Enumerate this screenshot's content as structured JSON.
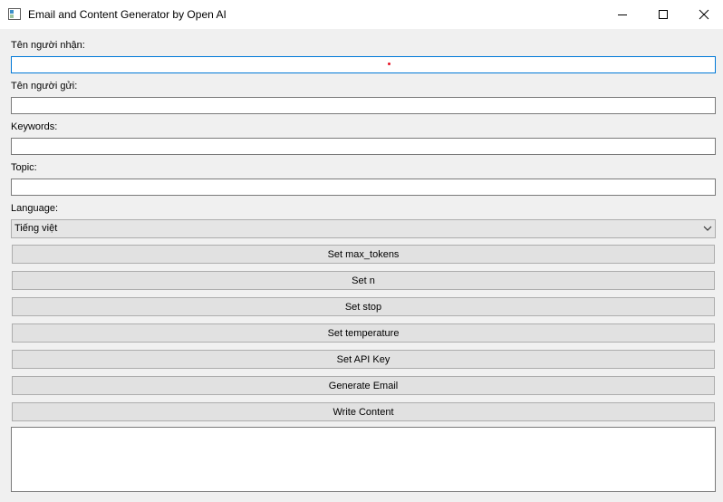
{
  "window": {
    "title": "Email and Content Generator by Open AI",
    "app_icon": "window-icon",
    "controls": [
      "minimize-icon",
      "maximize-icon",
      "close-icon"
    ]
  },
  "form": {
    "recipient": {
      "label": "Tên người nhận:",
      "value": ""
    },
    "sender": {
      "label": "Tên người gửi:",
      "value": ""
    },
    "keywords": {
      "label": "Keywords:",
      "value": ""
    },
    "topic": {
      "label": "Topic:",
      "value": ""
    },
    "language": {
      "label": "Language:",
      "selected": "Tiếng việt"
    }
  },
  "buttons": {
    "max_tokens": "Set max_tokens",
    "n": "Set n",
    "stop": "Set stop",
    "temperature": "Set temperature",
    "api_key": "Set API Key",
    "generate_email": "Generate Email",
    "write_content": "Write Content"
  },
  "output": {
    "value": ""
  },
  "colors": {
    "focus_border": "#0078d7",
    "background": "#f0f0f0",
    "button": "#e1e1e1"
  }
}
